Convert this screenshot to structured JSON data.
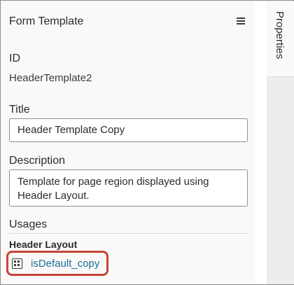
{
  "panel": {
    "title": "Form Template"
  },
  "fields": {
    "id_label": "ID",
    "id_value": "HeaderTemplate2",
    "title_label": "Title",
    "title_value": "Header Template Copy",
    "description_label": "Description",
    "description_value": "Template for page region displayed using\nHeader Layout."
  },
  "usages": {
    "label": "Usages",
    "group_label": "Header Layout",
    "link_label": "isDefault_copy",
    "link_icon": "form-layout-icon"
  },
  "side_tabs": {
    "properties_label": "Properties"
  },
  "colors": {
    "link": "#1a6d9a",
    "highlight_border": "#c5453a",
    "panel_bg": "#fbf9f8",
    "rail_bg": "#efedeb"
  }
}
